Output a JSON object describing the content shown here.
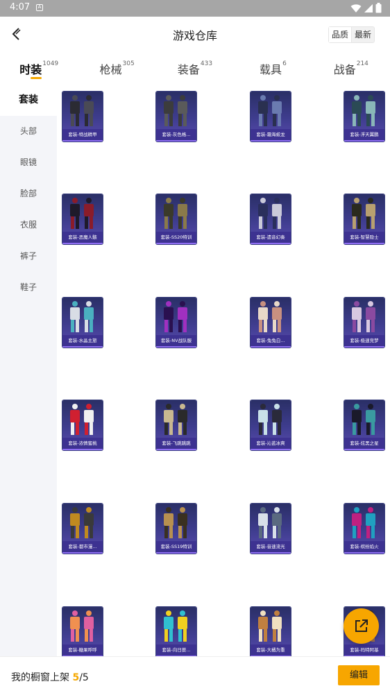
{
  "status": {
    "time": "4:07",
    "notif": "A"
  },
  "header": {
    "title": "游戏仓库",
    "sort_options": [
      "品质",
      "最新"
    ]
  },
  "tabs": [
    {
      "label": "时装",
      "count": "1049"
    },
    {
      "label": "枪械",
      "count": "305"
    },
    {
      "label": "装备",
      "count": "433"
    },
    {
      "label": "载具",
      "count": "6"
    },
    {
      "label": "战备",
      "count": "214"
    }
  ],
  "sidebar": {
    "items": [
      "套装",
      "头部",
      "眼镜",
      "脸部",
      "衣服",
      "裤子",
      "鞋子"
    ]
  },
  "items": [
    {
      "name": "套装-特战精甲",
      "c1": "#2b2b33",
      "c2": "#4a4a55"
    },
    {
      "name": "套装-灰色格...",
      "c1": "#3c3c3c",
      "c2": "#5a5a5a"
    },
    {
      "name": "套装-霜海蛟龙",
      "c1": "#2a3050",
      "c2": "#6a7bb0"
    },
    {
      "name": "套装-浮天翼鹏",
      "c1": "#2b4a55",
      "c2": "#8ab7b8"
    },
    {
      "name": "套装-恶魔人骸",
      "c1": "#1e1a2a",
      "c2": "#8a1c2a"
    },
    {
      "name": "套装-SS20特训",
      "c1": "#3b3a2a",
      "c2": "#8a7a4a"
    },
    {
      "name": "套装-遗音幻奏",
      "c1": "#2a2f5c",
      "c2": "#c9c9d9"
    },
    {
      "name": "套装-智慧隐士",
      "c1": "#2a2a1e",
      "c2": "#b8a070"
    },
    {
      "name": "套装-水晶主旅",
      "c1": "#d8dde5",
      "c2": "#4ab0c0"
    },
    {
      "name": "套装-NV战队服",
      "c1": "#2a1050",
      "c2": "#a030c0"
    },
    {
      "name": "套装-兔兔白...",
      "c1": "#e8d8c8",
      "c2": "#c89080"
    },
    {
      "name": "套装-极速竞梦",
      "c1": "#d8c8e0",
      "c2": "#8a4aa0"
    },
    {
      "name": "套装-浓情蜜桃",
      "c1": "#d02030",
      "c2": "#f0f0f0"
    },
    {
      "name": "套装-飞跳跳跳",
      "c1": "#c8b890",
      "c2": "#2a2a2a"
    },
    {
      "name": "套装-沁蓝冰爽",
      "c1": "#c8e0e8",
      "c2": "#2a2a3a"
    },
    {
      "name": "套装-炫黑之星",
      "c1": "#1a1a2a",
      "c2": "#3a9aa0"
    },
    {
      "name": "套装-都市漫...",
      "c1": "#c08a20",
      "c2": "#3a3a3a"
    },
    {
      "name": "套装-SS19特训",
      "c1": "#b89050",
      "c2": "#3a3020"
    },
    {
      "name": "套装-音速流光",
      "c1": "#d8e0e8",
      "c2": "#5a6a80"
    },
    {
      "name": "套装-缤纷焰火",
      "c1": "#c02080",
      "c2": "#20a0c0"
    },
    {
      "name": "套装-糖果呼呼",
      "c1": "#f09050",
      "c2": "#e060a0"
    },
    {
      "name": "套装-向日葵...",
      "c1": "#30c0d0",
      "c2": "#f0d020"
    },
    {
      "name": "套装-大橘为重",
      "c1": "#c08040",
      "c2": "#f0e0c0"
    },
    {
      "name": "套装-玛特阿基",
      "c1": "#3a2a20",
      "c2": "#a07050"
    }
  ],
  "bottom": {
    "prefix": "我的橱窗上架 ",
    "current": "5",
    "separator": "/",
    "total": "5",
    "edit_label": "编辑"
  }
}
